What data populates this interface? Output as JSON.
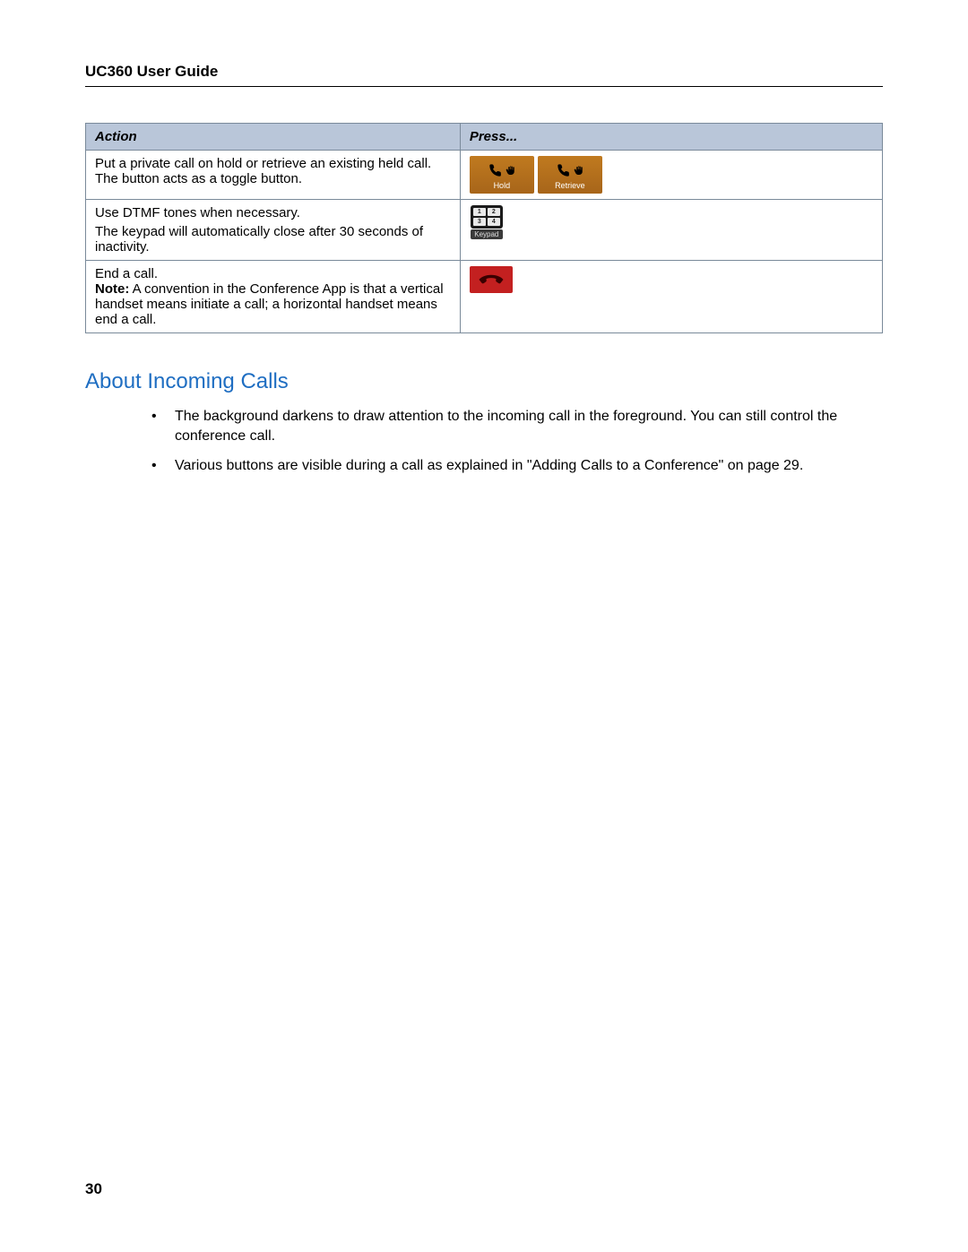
{
  "header": {
    "title": "UC360 User Guide"
  },
  "table": {
    "headers": {
      "action": "Action",
      "press": "Press..."
    },
    "rows": {
      "r1": {
        "action": "Put a private call on hold or retrieve an existing held call. The button acts as a toggle button.",
        "press_btn_hold_label": "Hold",
        "press_btn_retrieve_label": "Retrieve"
      },
      "r2": {
        "action_line1": "Use DTMF tones when necessary.",
        "action_line2": "The keypad will automatically close after 30 seconds of inactivity.",
        "keypad_label": "Keypad"
      },
      "r3": {
        "action_line1": "End a call.",
        "note_label": "Note:",
        "note_text": " A convention in the Conference App is that a vertical handset means initiate a call; a horizontal handset means end a call."
      }
    }
  },
  "section": {
    "heading": "About Incoming Calls",
    "bullets": {
      "b1": "The background darkens to draw attention to the incoming call in the foreground. You can still control the conference call.",
      "b2": "Various buttons are visible during a call as explained in \"Adding Calls to a Conference\" on page 29."
    }
  },
  "page_number": "30"
}
